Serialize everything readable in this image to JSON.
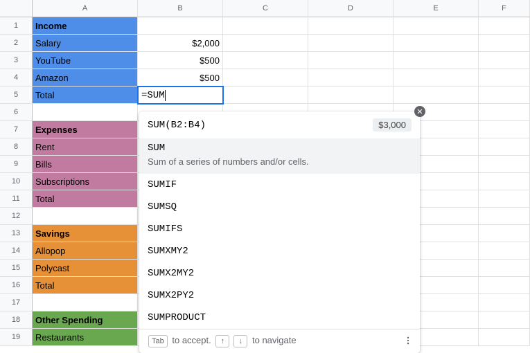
{
  "columns": [
    "A",
    "B",
    "C",
    "D",
    "E",
    "F"
  ],
  "rows": [
    "1",
    "2",
    "3",
    "4",
    "5",
    "6",
    "7",
    "8",
    "9",
    "10",
    "11",
    "12",
    "13",
    "14",
    "15",
    "16",
    "17",
    "18",
    "19"
  ],
  "cells": {
    "A1": "Income",
    "A2": "Salary",
    "A3": "YouTube",
    "A4": "Amazon",
    "A5": "Total",
    "A7": "Expenses",
    "A8": "Rent",
    "A9": "Bills",
    "A10": "Subscriptions",
    "A11": "Total",
    "A13": "Savings",
    "A14": "Allopop",
    "A15": "Polycast",
    "A16": "Total",
    "A18": "Other Spending",
    "A19": "Restaurants",
    "B2": "$2,000",
    "B3": "$500",
    "B4": "$500"
  },
  "active_formula": "=SUM",
  "autocomplete": {
    "first_suggestion": "SUM(B2:B4)",
    "preview": "$3,000",
    "selected": {
      "name": "SUM",
      "desc": "Sum of a series of numbers and/or cells."
    },
    "items": [
      "SUMIF",
      "SUMSQ",
      "SUMIFS",
      "SUMXMY2",
      "SUMX2MY2",
      "SUMX2PY2",
      "SUMPRODUCT"
    ],
    "hint": {
      "tab": "Tab",
      "accept": "to accept.",
      "up": "↑",
      "down": "↓",
      "nav": "to navigate"
    }
  }
}
